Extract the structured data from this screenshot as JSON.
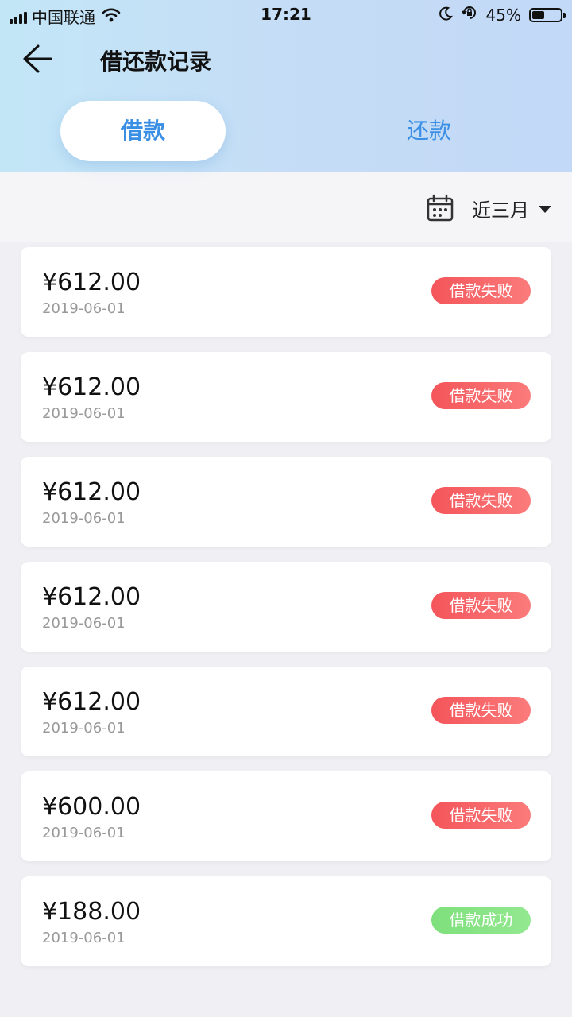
{
  "status_bar": {
    "carrier": "中国联通",
    "time": "17:21",
    "battery": "45%",
    "battery_level": 0.45
  },
  "header": {
    "title": "借还款记录",
    "back_icon": "arrow-left-icon"
  },
  "tabs": [
    {
      "label": "借款",
      "active": true
    },
    {
      "label": "还款",
      "active": false
    }
  ],
  "filter": {
    "icon": "calendar-icon",
    "label": "近三月"
  },
  "records": [
    {
      "amount": "¥612.00",
      "date": "2019-06-01",
      "status": "借款失败",
      "type": "fail"
    },
    {
      "amount": "¥612.00",
      "date": "2019-06-01",
      "status": "借款失败",
      "type": "fail"
    },
    {
      "amount": "¥612.00",
      "date": "2019-06-01",
      "status": "借款失败",
      "type": "fail"
    },
    {
      "amount": "¥612.00",
      "date": "2019-06-01",
      "status": "借款失败",
      "type": "fail"
    },
    {
      "amount": "¥612.00",
      "date": "2019-06-01",
      "status": "借款失败",
      "type": "fail"
    },
    {
      "amount": "¥600.00",
      "date": "2019-06-01",
      "status": "借款失败",
      "type": "fail"
    },
    {
      "amount": "¥188.00",
      "date": "2019-06-01",
      "status": "借款成功",
      "type": "ok"
    }
  ],
  "colors": {
    "accent": "#3a8fe4",
    "fail": "#f4555a",
    "success": "#7ee07c"
  }
}
